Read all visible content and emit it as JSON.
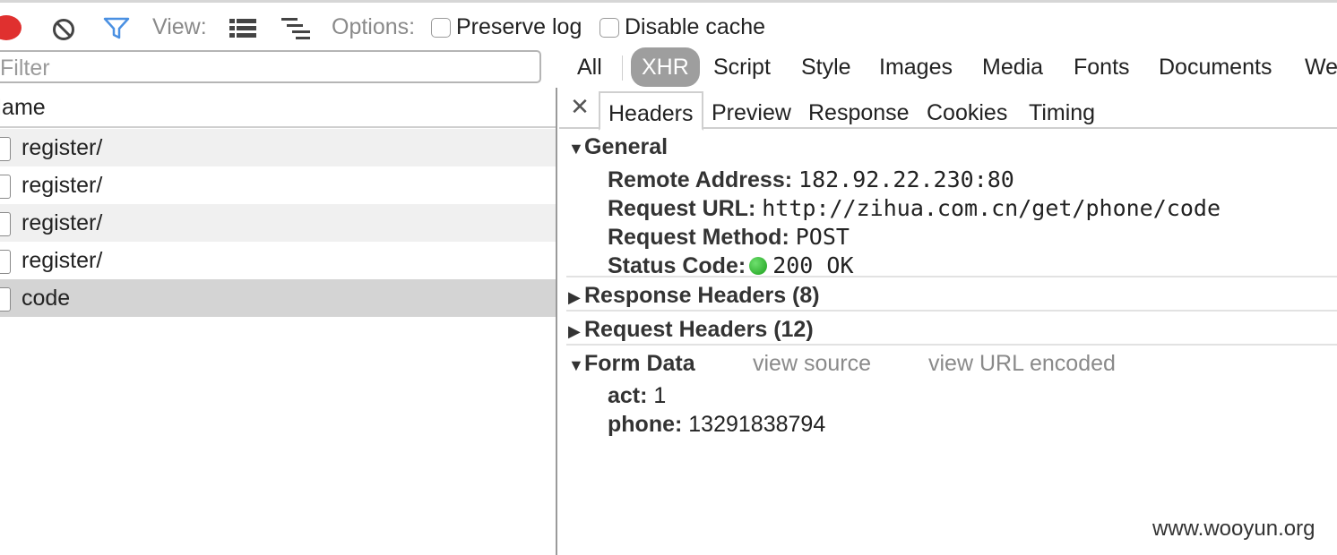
{
  "toolbar": {
    "view_label": "View:",
    "options_label": "Options:",
    "preserve_log_label": "Preserve log",
    "preserve_log_checked": false,
    "disable_cache_label": "Disable cache",
    "disable_cache_checked": false,
    "icons": [
      "record-icon",
      "clear-icon",
      "filter-icon",
      "large-request-rows-icon",
      "overview-waterfall-icon"
    ],
    "accent_color": "#4a90e2",
    "record_color": "#e0302f"
  },
  "filter": {
    "placeholder": "Filter"
  },
  "type_filters": {
    "items": [
      "All",
      "XHR",
      "Script",
      "Style",
      "Images",
      "Media",
      "Fonts",
      "Documents",
      "We"
    ],
    "selected": "XHR"
  },
  "request_list": {
    "header": "Name",
    "rows": [
      {
        "name": "register/"
      },
      {
        "name": "register/"
      },
      {
        "name": "register/"
      },
      {
        "name": "register/"
      },
      {
        "name": "code"
      }
    ],
    "selected_index": 4
  },
  "detail": {
    "tabs": [
      "Headers",
      "Preview",
      "Response",
      "Cookies",
      "Timing"
    ],
    "active_tab": "Headers",
    "general": {
      "title": "General",
      "remote_address_key": "Remote Address:",
      "remote_address": "182.92.22.230:80",
      "request_url_key": "Request URL:",
      "request_url": "http://zihua.com.cn/get/phone/code",
      "request_method_key": "Request Method:",
      "request_method": "POST",
      "status_code_key": "Status Code:",
      "status_code": "200 OK",
      "status_color": "#1c9f1c"
    },
    "response_headers": "Response Headers (8)",
    "request_headers": "Request Headers (12)",
    "form_data": {
      "title": "Form Data",
      "view_source": "view source",
      "view_url_encoded": "view URL encoded",
      "act_key": "act:",
      "act": "1",
      "phone_key": "phone:",
      "phone": "13291838794"
    }
  },
  "watermark": "www.wooyun.org"
}
